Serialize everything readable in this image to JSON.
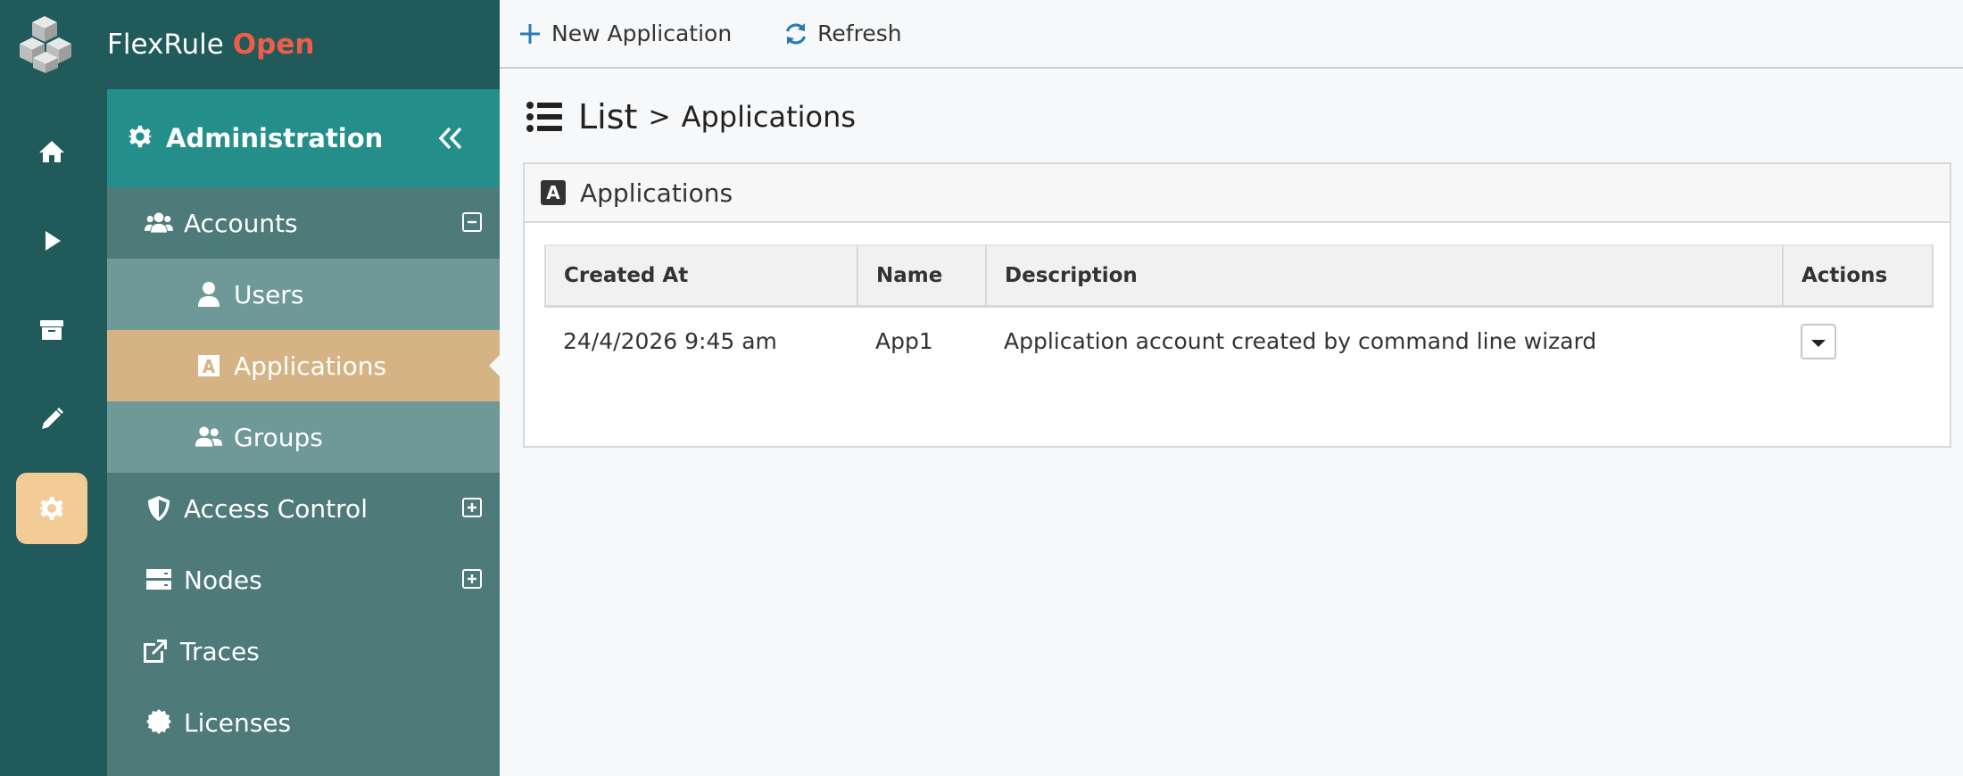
{
  "brand": {
    "name": "FlexRule",
    "suffix": "Open"
  },
  "rail": {
    "items": [
      {
        "icon": "home-icon"
      },
      {
        "icon": "play-icon"
      },
      {
        "icon": "archive-icon"
      },
      {
        "icon": "pencil-icon"
      },
      {
        "icon": "gear-icon",
        "active": true
      }
    ]
  },
  "nav": {
    "header": "Administration",
    "items": [
      {
        "label": "Accounts",
        "icon": "users-icon",
        "toggle": "collapse"
      },
      {
        "label": "Users",
        "icon": "user-icon"
      },
      {
        "label": "Applications",
        "icon": "app-icon",
        "active": true
      },
      {
        "label": "Groups",
        "icon": "group-icon"
      },
      {
        "label": "Access Control",
        "icon": "shield-icon",
        "toggle": "expand"
      },
      {
        "label": "Nodes",
        "icon": "server-icon",
        "toggle": "expand"
      },
      {
        "label": "Traces",
        "icon": "external-link-icon"
      },
      {
        "label": "Licenses",
        "icon": "certificate-icon"
      }
    ]
  },
  "toolbar": {
    "new_label": "New Application",
    "refresh_label": "Refresh"
  },
  "breadcrumb": {
    "root": "List",
    "separator": ">",
    "page": "Applications"
  },
  "panel": {
    "title": "Applications",
    "columns": [
      "Created At",
      "Name",
      "Description",
      "Actions"
    ],
    "rows": [
      {
        "created_at": "24/4/2026 9:45 am",
        "name": "App1",
        "description": "Application account created by command line wizard"
      }
    ]
  },
  "colors": {
    "rail_bg": "#215a5a",
    "nav_bg": "#4f7a7a",
    "nav_header_bg": "#248f8a",
    "sub_bg": "#6f9898",
    "active_bg": "#d6b384",
    "rail_active": "#f2cc94",
    "brand_accent": "#ef5c4a",
    "toolbar_icon": "#2a7bb5"
  }
}
